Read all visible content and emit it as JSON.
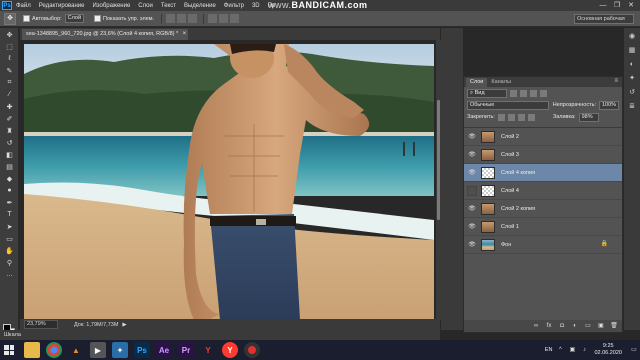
{
  "app": {
    "menu": [
      "Файл",
      "Редактирование",
      "Изображение",
      "Слои",
      "Текст",
      "Выделение",
      "Фильтр",
      "3D",
      "Пр"
    ],
    "watermark_prefix": "www.",
    "watermark": "BANDICAM.com",
    "window_controls": [
      "—",
      "❐",
      "✕"
    ]
  },
  "options": {
    "autoselect_label": "Автовыбор:",
    "autoselect_value": "Слой",
    "show_controls_label": "Показать упр. элем.",
    "workspace": "Основная рабочая"
  },
  "tools": [
    "move",
    "marquee",
    "lasso",
    "quick-select",
    "crop",
    "eyedropper",
    "healing",
    "brush",
    "clone",
    "history-brush",
    "eraser",
    "gradient",
    "blur",
    "dodge",
    "pen",
    "type",
    "path-select",
    "shape",
    "hand",
    "zoom",
    "more"
  ],
  "document": {
    "tab_title": "sea-1348895_960_720.jpg @ 23,6% (Слой 4 копия, RGB/8) *",
    "zoom": "23,79%",
    "doc_size": "Док: 1,79M/7,73M"
  },
  "bottom_tab": "Шкала",
  "layers_panel": {
    "tabs": [
      "Слои",
      "Каналы"
    ],
    "filter_label": "Вид",
    "blend_mode": "Обычные",
    "opacity_label": "Непрозрачность:",
    "opacity_value": "100%",
    "lock_label": "Закрепить:",
    "fill_label": "Заливка:",
    "fill_value": "98%",
    "layers": [
      {
        "name": "Слой 2",
        "visible": true,
        "selected": false,
        "thumb": "person"
      },
      {
        "name": "Слой 3",
        "visible": true,
        "selected": false,
        "thumb": "person"
      },
      {
        "name": "Слой 4 копия",
        "visible": true,
        "selected": true,
        "thumb": "check"
      },
      {
        "name": "Слой 4",
        "visible": false,
        "selected": false,
        "thumb": "check"
      },
      {
        "name": "Слой 2 копия",
        "visible": true,
        "selected": false,
        "thumb": "person"
      },
      {
        "name": "Слой 1",
        "visible": true,
        "selected": false,
        "thumb": "person"
      },
      {
        "name": "Фон",
        "visible": true,
        "selected": false,
        "thumb": "beach",
        "locked": true
      }
    ]
  },
  "taskbar": {
    "apps": [
      "explorer",
      "chrome",
      "vlc",
      "media",
      "app",
      "photoshop",
      "after-effects",
      "premiere",
      "yandex",
      "yandex-browser",
      "bandicam"
    ],
    "language": "EN",
    "time": "9:25",
    "date": "02.06.2020"
  },
  "colors": {
    "selection": "#6d87a8",
    "panel": "#535353",
    "taskbar": "#1a1e2e"
  }
}
